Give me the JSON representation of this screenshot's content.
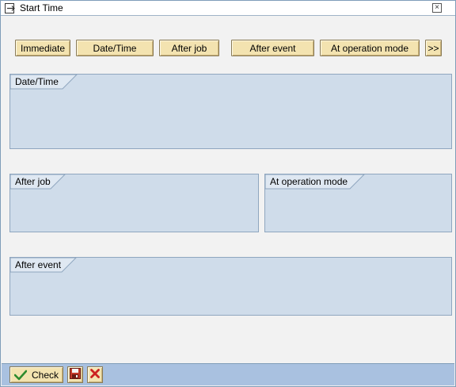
{
  "window": {
    "title": "Start Time",
    "close_symbol": "×"
  },
  "toolbar": {
    "immediate_label": "Immediate",
    "datetime_label": "Date/Time",
    "after_job_label": "After job",
    "after_event_label": "After event",
    "at_operation_mode_label": "At operation mode",
    "more_label": ">>"
  },
  "groups": {
    "datetime_title": "Date/Time",
    "after_job_title": "After job",
    "at_operation_mode_title": "At operation mode",
    "after_event_title": "After event"
  },
  "footer": {
    "check_label": "Check",
    "check_icon": "checkmark-icon",
    "save_icon": "save-icon",
    "cancel_icon": "cancel-icon"
  },
  "colors": {
    "button_face": "#f3e3b0",
    "group_fill": "#cfdcea",
    "footer_bar": "#a9c1e0",
    "check_green": "#2e8b2e",
    "cancel_red": "#cc2222"
  }
}
